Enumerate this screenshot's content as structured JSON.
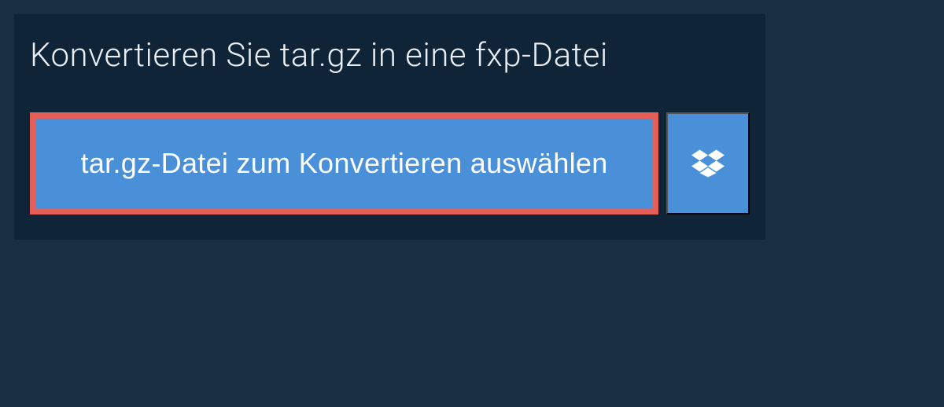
{
  "heading": "Konvertieren Sie tar.gz in eine fxp-Datei",
  "buttons": {
    "select_file_label": "tar.gz-Datei zum Konvertieren auswählen"
  }
}
